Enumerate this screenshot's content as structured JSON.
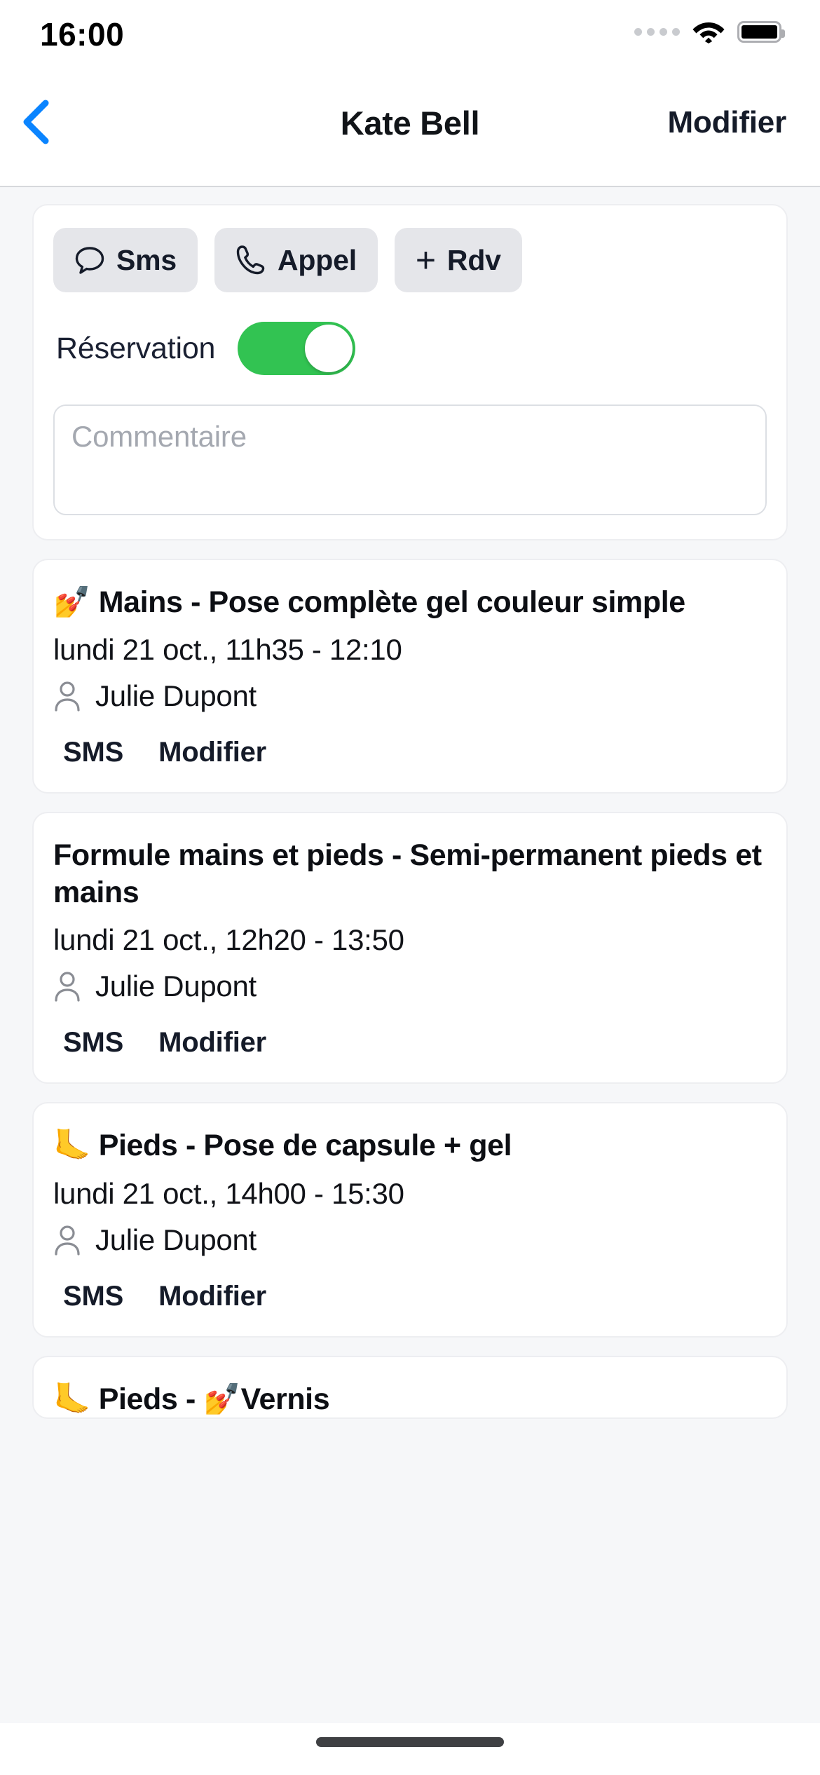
{
  "statusbar": {
    "time": "16:00",
    "cellular_icon": "cellular-dots-icon",
    "wifi_icon": "wifi-icon",
    "battery_icon": "battery-full-icon"
  },
  "navbar": {
    "back_icon": "chevron-left-icon",
    "title": "Kate Bell",
    "action_label": "Modifier",
    "accent_color": "#0a84ff"
  },
  "contact_card": {
    "actions": [
      {
        "label": "Sms",
        "icon": "message-bubble-icon"
      },
      {
        "label": "Appel",
        "icon": "phone-icon"
      },
      {
        "label": "Rdv",
        "icon": "plus-icon"
      }
    ],
    "reservation": {
      "label": "Réservation",
      "enabled": true,
      "on_color": "#32c352"
    },
    "comment": {
      "value": "",
      "placeholder": "Commentaire"
    }
  },
  "appointments": [
    {
      "emoji": "💅",
      "title": "Mains - Pose complète gel couleur simple",
      "date": "lundi 21 oct., 11h35 - 12:10",
      "person_icon": "person-icon",
      "person": "Julie Dupont",
      "sms_label": "SMS",
      "edit_label": "Modifier"
    },
    {
      "emoji": "",
      "title": "Formule mains et pieds - Semi-permanent pieds et mains",
      "date": "lundi 21 oct., 12h20 - 13:50",
      "person_icon": "person-icon",
      "person": "Julie Dupont",
      "sms_label": "SMS",
      "edit_label": "Modifier"
    },
    {
      "emoji": "🦶",
      "title": "Pieds - Pose de capsule + gel",
      "date": "lundi 21 oct., 14h00 - 15:30",
      "person_icon": "person-icon",
      "person": "Julie Dupont",
      "sms_label": "SMS",
      "edit_label": "Modifier"
    },
    {
      "emoji": "🦶",
      "title": "Pieds - 💅Vernis",
      "date": "",
      "person_icon": "person-icon",
      "person": "",
      "sms_label": "",
      "edit_label": ""
    }
  ],
  "home_indicator": "home-indicator"
}
